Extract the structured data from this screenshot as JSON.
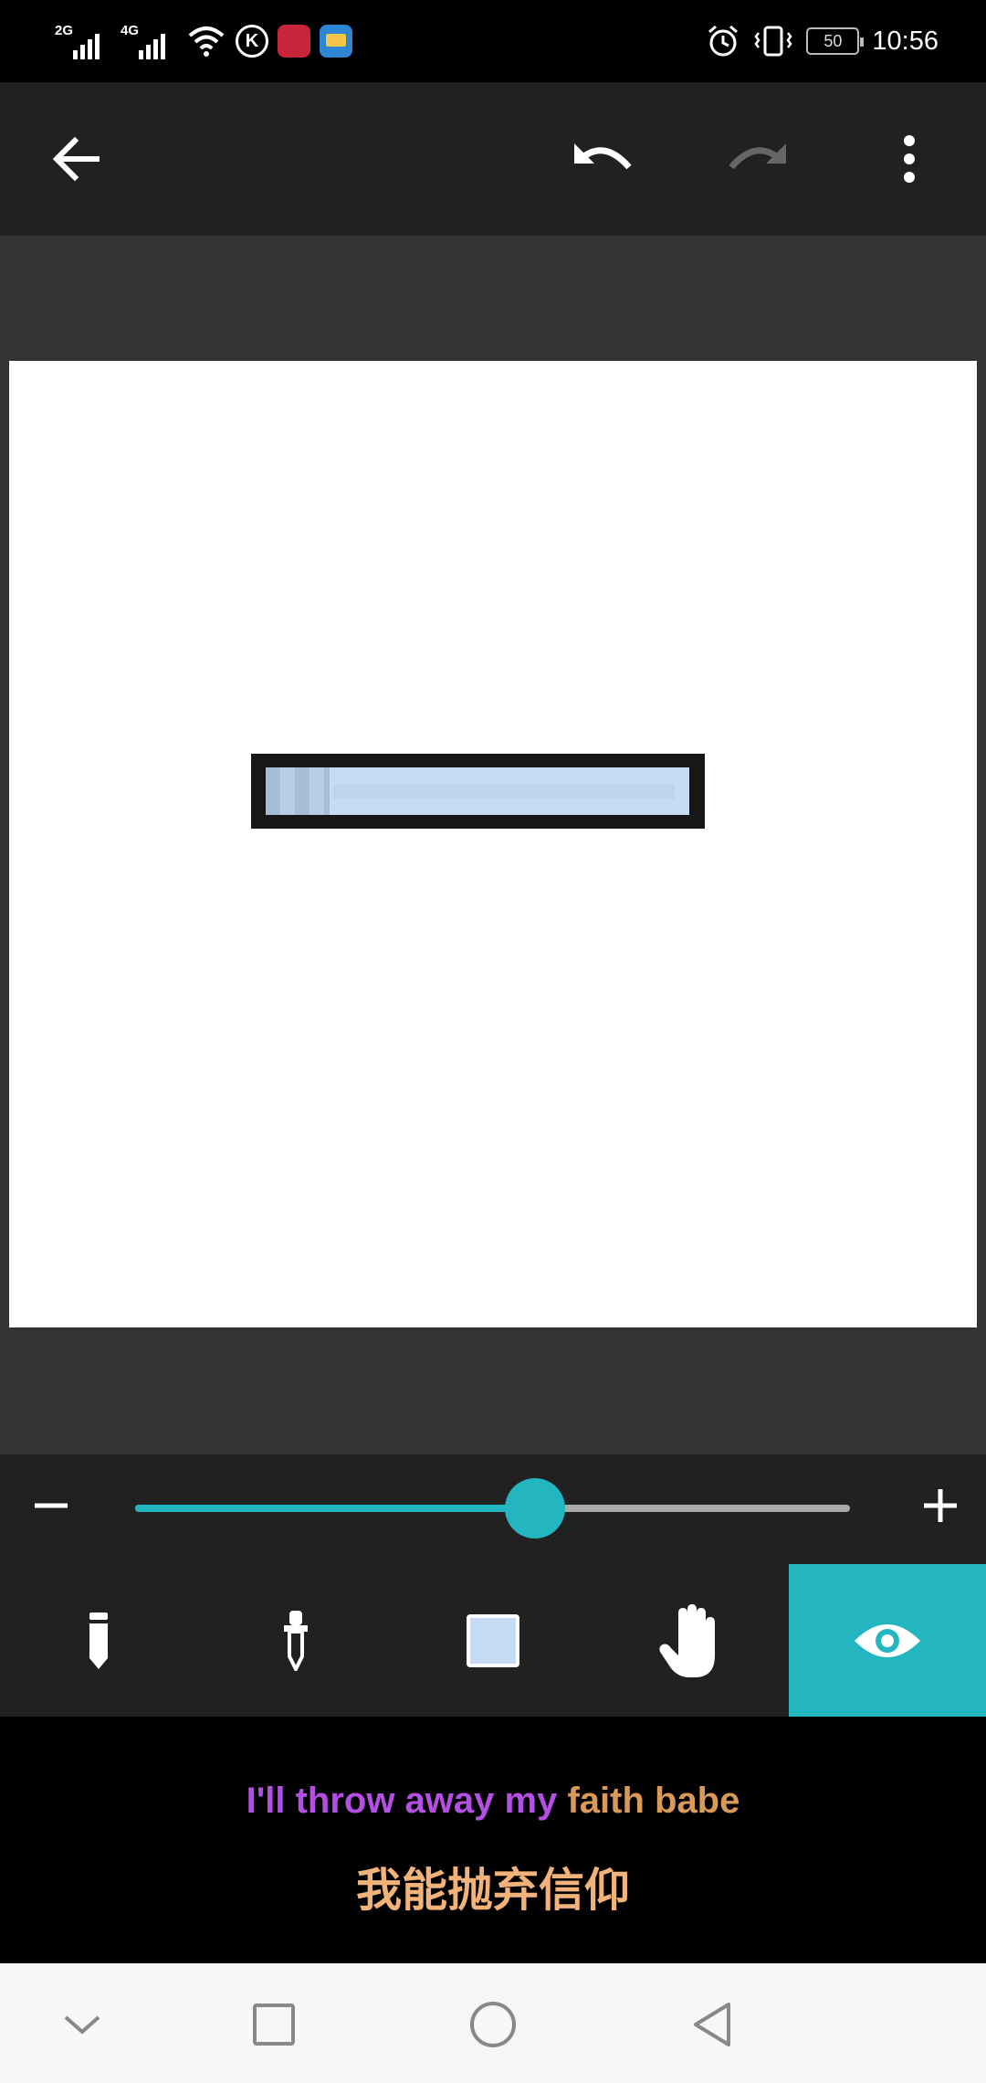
{
  "status_bar": {
    "signal_1_label": "2G",
    "signal_2_label": "4G",
    "k_icon_label": "K",
    "battery_level": "50",
    "time": "10:56"
  },
  "toolbar": {
    "back_icon": "arrow-left-icon",
    "undo_icon": "undo-icon",
    "redo_icon": "redo-icon",
    "more_icon": "more-vert-icon",
    "redo_enabled": false
  },
  "canvas": {
    "background": "#ffffff",
    "progress_fill_fraction": 0.15,
    "progress_colors": {
      "frame": "#171717",
      "track": "#c7dcf3",
      "fill": "#a7bdd6"
    }
  },
  "brush_slider": {
    "minus_icon": "minus-icon",
    "plus_icon": "plus-icon",
    "value_fraction": 0.56,
    "accent": "#24b6c0"
  },
  "tools": [
    {
      "id": "pencil",
      "icon": "pencil-icon",
      "active": false
    },
    {
      "id": "eyedropper",
      "icon": "eyedropper-icon",
      "active": false
    },
    {
      "id": "color",
      "icon": "color-swatch-icon",
      "swatch": "#c5dbf4",
      "active": false
    },
    {
      "id": "pan",
      "icon": "hand-icon",
      "active": false
    },
    {
      "id": "preview",
      "icon": "eye-icon",
      "active": true
    }
  ],
  "lyrics": {
    "english_sung": "I'll throw away my",
    "english_rest": " faith babe",
    "chinese": "我能抛弃信仰"
  },
  "nav_bar": {
    "icons": [
      "chevron-down-icon",
      "square-icon",
      "circle-icon",
      "triangle-back-icon"
    ]
  }
}
